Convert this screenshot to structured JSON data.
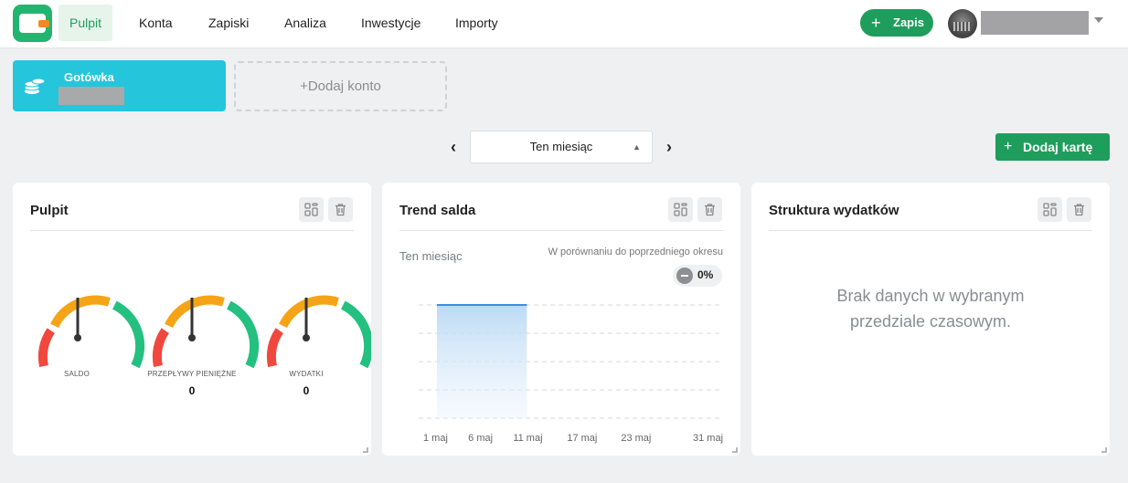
{
  "nav": {
    "items": [
      "Pulpit",
      "Konta",
      "Zapiski",
      "Analiza",
      "Inwestycje",
      "Importy"
    ],
    "add_record_label": "Zapis"
  },
  "accounts": {
    "cash_name": "Gotówka",
    "add_account_label": "Dodaj konto"
  },
  "period": {
    "selected": "Ten miesiąc"
  },
  "add_card_label": "Dodaj kartę",
  "cards": {
    "dashboard": {
      "title": "Pulpit",
      "gauges": [
        {
          "label": "SALDO",
          "value": ""
        },
        {
          "label": "PRZEPŁYWY PIENIĘŻNE",
          "value": "0"
        },
        {
          "label": "WYDATKI",
          "value": "0"
        }
      ]
    },
    "trend": {
      "title": "Trend salda",
      "period_label": "Ten miesiąc",
      "comparison_label": "W porównaniu do poprzedniego okresu",
      "change": "0%"
    },
    "structure": {
      "title": "Struktura wydatków",
      "empty_message": "Brak danych w wybranym przedziale czasowym."
    }
  },
  "colors": {
    "brand_green": "#1f9d5c",
    "account_cyan": "#25c5dc",
    "gauge_red": "#f0483e",
    "gauge_orange": "#f5a417",
    "gauge_green": "#23c080",
    "chart_line": "#3b8fe0"
  },
  "chart_data": {
    "type": "area",
    "x": [
      "1 maj",
      "6 maj",
      "11 maj",
      "17 maj",
      "23 maj",
      "31 maj"
    ],
    "tick_labels": [
      "1 maj",
      "6 maj",
      "11 maj",
      "17 maj",
      "23 maj",
      "31 maj"
    ],
    "series": [
      {
        "points": [
          [
            "1 maj",
            1
          ],
          [
            "6 maj",
            1
          ],
          [
            "11 maj",
            1
          ]
        ]
      }
    ],
    "grid": true,
    "title": "",
    "xlabel": "",
    "ylabel": ""
  }
}
